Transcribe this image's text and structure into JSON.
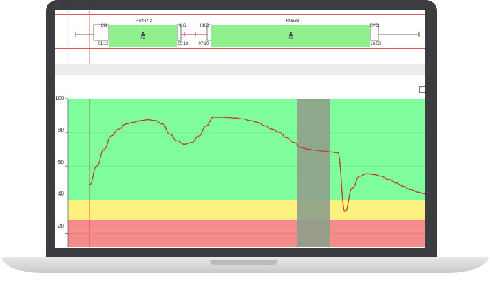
{
  "timeline": {
    "flights": [
      {
        "code": "RU447-2",
        "origin": "ICN",
        "destination": "HKG",
        "departure": "01:12",
        "arrival": "05:18",
        "pax": "+2"
      },
      {
        "code": "RU538",
        "origin": "HKG",
        "destination": "SVO",
        "departure": "07:20",
        "arrival": "16:50",
        "pax": "+2"
      }
    ]
  },
  "chart_data": {
    "type": "line",
    "ylim": [
      12,
      100
    ],
    "yticks": [
      20,
      40,
      60,
      80,
      100
    ],
    "zones": [
      {
        "from": 0,
        "to": 28,
        "color": "#f48c8c"
      },
      {
        "from": 28,
        "to": 40,
        "color": "#fff180"
      },
      {
        "from": 40,
        "to": 100,
        "color": "#80fd9c"
      }
    ],
    "highlight_band_color": "#8e9e8a",
    "line_color": "#c0392b",
    "series": [
      {
        "values": [
          49,
          60,
          70,
          78,
          82,
          85,
          86,
          87,
          87.5,
          87,
          85,
          79,
          75,
          73,
          74,
          78,
          84,
          89,
          89,
          88.8,
          88.5,
          88,
          87,
          86,
          84,
          82,
          80,
          77,
          74,
          71,
          70,
          69.5,
          69,
          68.5,
          68,
          33,
          47,
          54,
          55.5,
          55,
          54,
          52,
          50,
          48,
          46,
          44.5,
          43.5
        ]
      }
    ]
  }
}
